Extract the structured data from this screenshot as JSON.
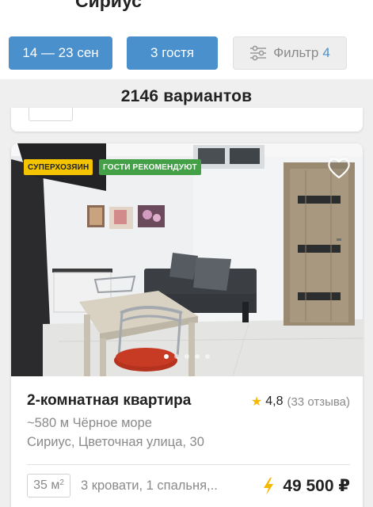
{
  "header": {
    "title": "Сириус"
  },
  "chips": {
    "dates": "14 — 23 сен",
    "guests": "3 гостя",
    "filter_label": "Фильтр",
    "filter_count": "4"
  },
  "results": {
    "count_text": "2146 вариантов"
  },
  "listing": {
    "badges": [
      "СУПЕРХОЗЯИН",
      "ГОСТИ РЕКОМЕНДУЮТ"
    ],
    "photo_count": 5,
    "active_photo": 1,
    "title": "2-комнатная квартира",
    "rating": "4,8",
    "reviews": "(33 отзыва)",
    "distance": "~580 м Чёрное море",
    "address": "Сириус, Цветочная улица, 30",
    "area": "35 м",
    "area_unit_sup": "2",
    "beds": "3 кровати, 1 спальня,..",
    "price": "49 500 ₽"
  },
  "colors": {
    "accent": "#4a90cd",
    "superhost": "#f5c400",
    "recommended": "#43a047",
    "star": "#f5b800",
    "bolt": "#f5b800"
  },
  "icons": {
    "back": "chevron-left-icon",
    "filter": "sliders-icon",
    "favorite": "heart-outline-icon",
    "rating": "star-icon",
    "instant_book": "lightning-bolt-icon"
  }
}
